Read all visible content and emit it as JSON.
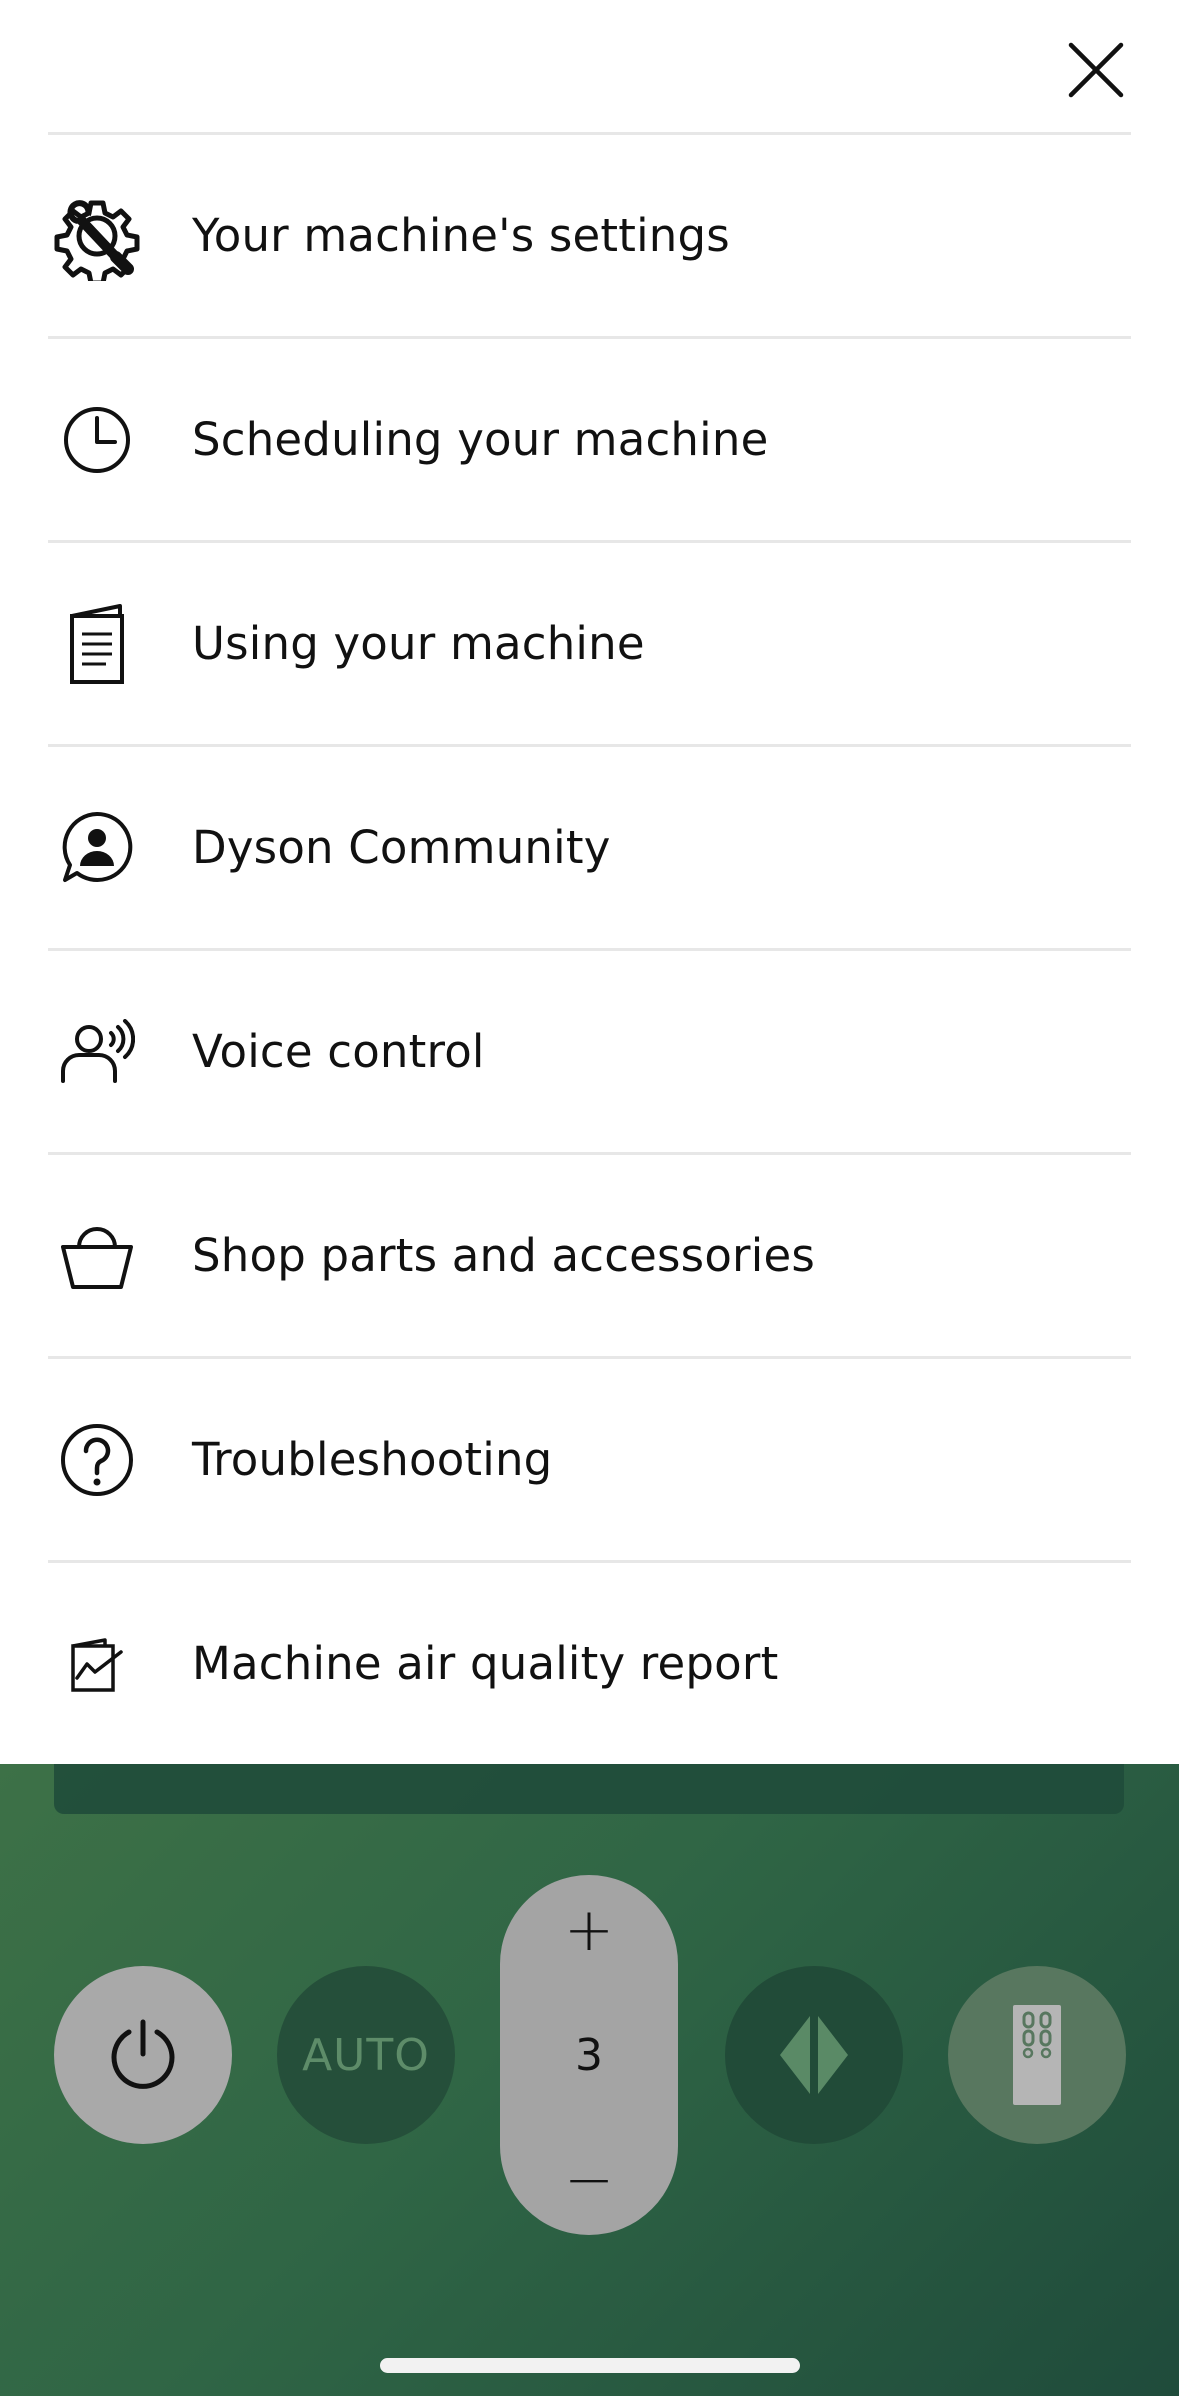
{
  "menu": {
    "items": [
      {
        "label": "Your machine's settings",
        "icon": "settings-wrench-icon"
      },
      {
        "label": "Scheduling your machine",
        "icon": "clock-icon"
      },
      {
        "label": "Using your machine",
        "icon": "document-icon"
      },
      {
        "label": "Dyson Community",
        "icon": "community-chat-icon"
      },
      {
        "label": "Voice control",
        "icon": "voice-control-icon"
      },
      {
        "label": "Shop parts and accessories",
        "icon": "shopping-basket-icon"
      },
      {
        "label": "Troubleshooting",
        "icon": "help-icon"
      },
      {
        "label": "Machine air quality report",
        "icon": "report-chart-icon"
      }
    ]
  },
  "controls": {
    "auto_label": "AUTO",
    "fan_speed": "3",
    "increase_label": "+",
    "decrease_label": "−"
  },
  "colors": {
    "panel_green": "#2f6545",
    "button_grey": "#a9a9a9"
  }
}
